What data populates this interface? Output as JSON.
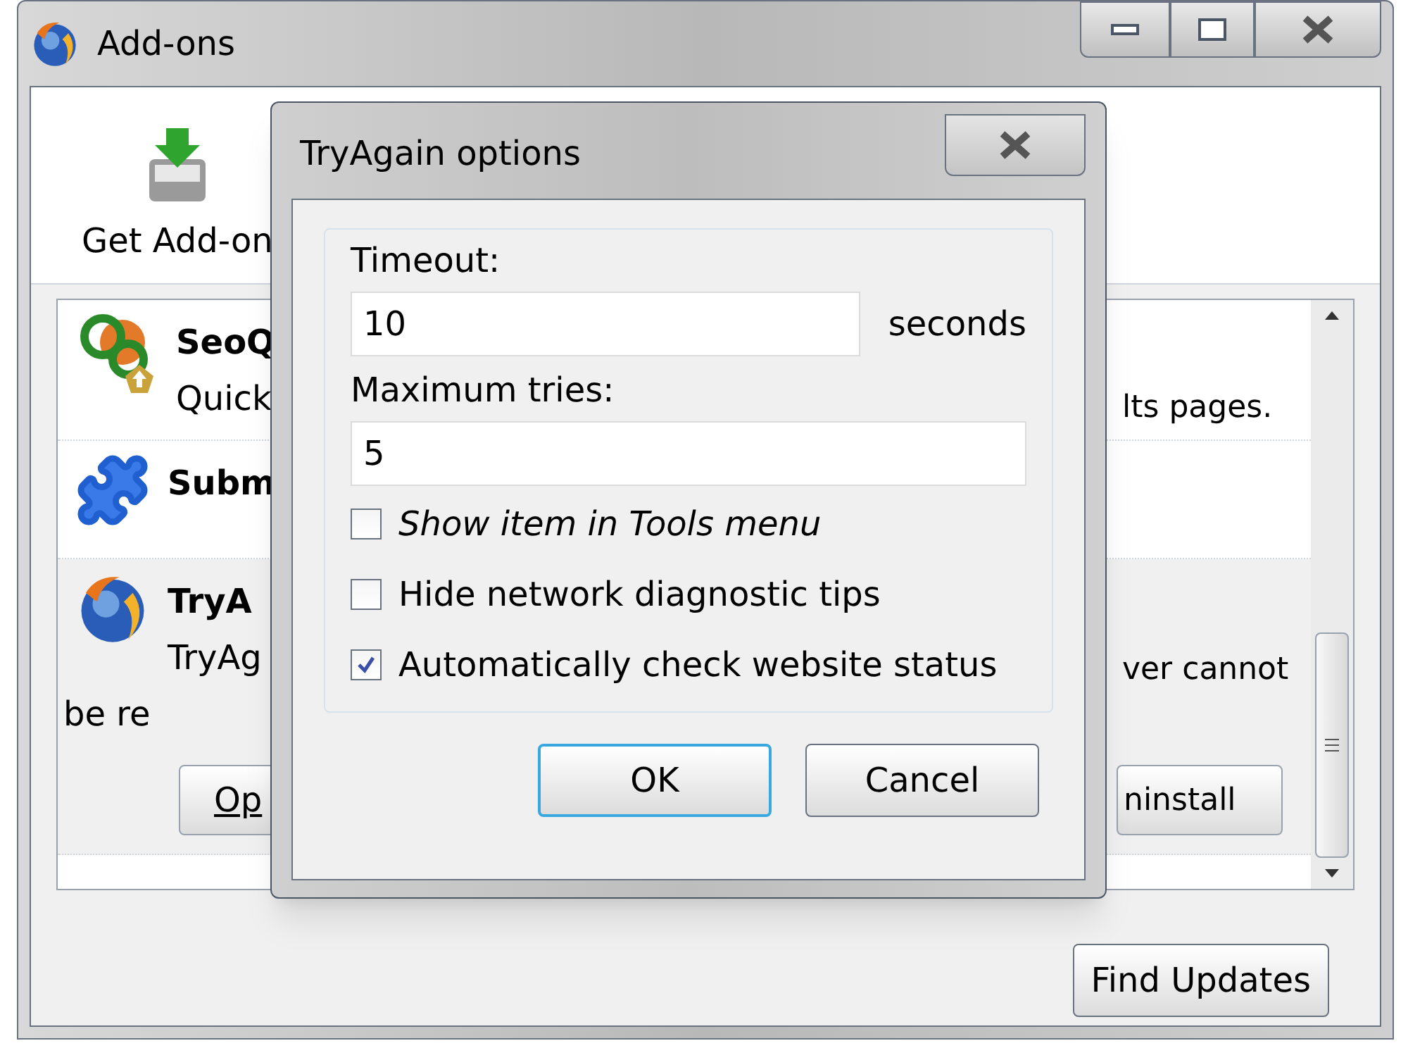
{
  "window": {
    "title": "Add-ons"
  },
  "toolbar": [
    {
      "label": "Get Add-on",
      "selected": false
    }
  ],
  "addons": [
    {
      "kind": "seo",
      "name": "SeoQ",
      "description": "Quick",
      "description_end": "lts pages.",
      "selected": false
    },
    {
      "kind": "puzzle",
      "name": "Subm",
      "selected": false
    },
    {
      "kind": "globe",
      "name": "TryA",
      "description": "TryAg",
      "description_end": "ver cannot",
      "description_line2": "be re",
      "selected": true,
      "buttons": [
        "Op",
        "ninstall"
      ]
    }
  ],
  "find_updates": "Find Updates",
  "dialog": {
    "title": "TryAgain options",
    "timeout_label": "Timeout:",
    "timeout_value": "10",
    "timeout_unit": "seconds",
    "tries_label": "Maximum tries:",
    "tries_value": "5",
    "options": [
      {
        "label": "Show item in Tools menu",
        "checked": false
      },
      {
        "label": "Hide network diagnostic tips",
        "checked": false
      },
      {
        "label": "Automatically check website status",
        "checked": true
      }
    ],
    "buttons": [
      {
        "label": "OK",
        "default": true
      },
      {
        "label": "Cancel",
        "default": false
      }
    ]
  }
}
